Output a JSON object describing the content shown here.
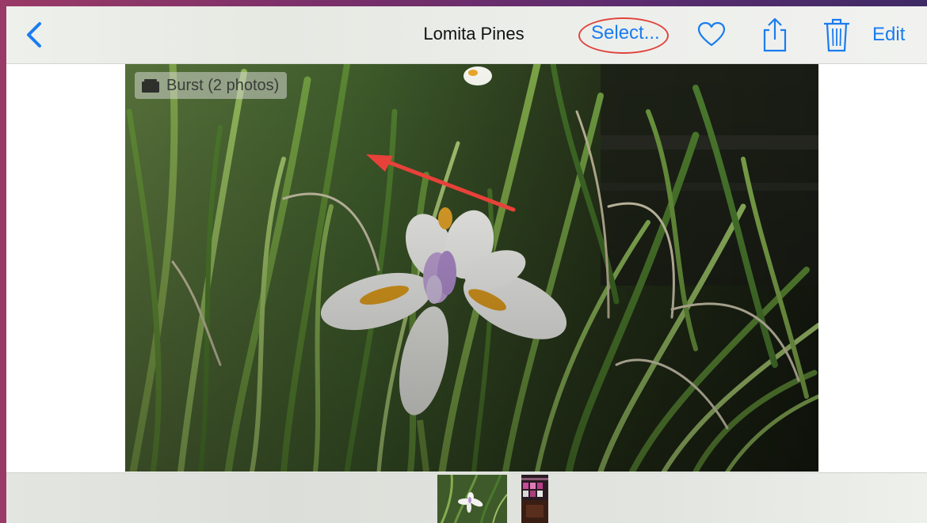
{
  "navbar": {
    "back_icon": "chevron-left-icon",
    "title": "Lomita Pines",
    "select_label": "Select...",
    "favorite_icon": "heart-icon",
    "share_icon": "share-icon",
    "delete_icon": "trash-icon",
    "edit_label": "Edit",
    "accent_color": "#1a7cf0"
  },
  "photo": {
    "burst_label": "Burst (2 photos)",
    "burst_icon": "burst-stack-icon"
  },
  "annotations": {
    "highlight_color": "#e0443e",
    "arrow_color": "#e8413a"
  },
  "filmstrip": {
    "thumbnails": [
      {
        "name": "iris-flower-thumbnail",
        "selected": true
      },
      {
        "name": "video-strip-thumbnail",
        "selected": false
      }
    ]
  }
}
